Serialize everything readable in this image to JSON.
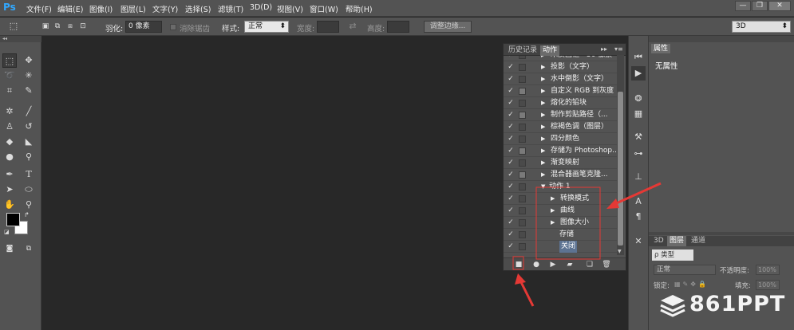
{
  "menubar": {
    "logo": "Ps",
    "items": [
      "文件(F)",
      "编辑(E)",
      "图像(I)",
      "图层(L)",
      "文字(Y)",
      "选择(S)",
      "滤镜(T)",
      "3D(D)",
      "视图(V)",
      "窗口(W)",
      "帮助(H)"
    ],
    "min": "—",
    "restore": "❐",
    "close": "✕"
  },
  "options": {
    "feather_label": "羽化:",
    "feather_value": "0 像素",
    "antialias_label": "消除锯齿",
    "style_label": "样式:",
    "style_value": "正常",
    "width_label": "宽度:",
    "height_label": "高度:",
    "refine_button": "调整边缘...",
    "workspace_value": "3D"
  },
  "actions_panel": {
    "tab_history": "历史记录",
    "tab_actions": "动作",
    "rows": [
      {
        "label": "木质画框 - 50 像素",
        "dialog": false,
        "expand": true,
        "indent": 0
      },
      {
        "label": "投影（文字）",
        "dialog": false,
        "expand": true,
        "indent": 0
      },
      {
        "label": "水中倒影（文字）",
        "dialog": false,
        "expand": true,
        "indent": 0
      },
      {
        "label": "自定义 RGB 到灰度",
        "dialog": true,
        "expand": true,
        "indent": 0
      },
      {
        "label": "熔化的铅块",
        "dialog": false,
        "expand": true,
        "indent": 0
      },
      {
        "label": "制作剪贴路径（...",
        "dialog": true,
        "expand": true,
        "indent": 0
      },
      {
        "label": "棕褐色调（图层）",
        "dialog": false,
        "expand": true,
        "indent": 0
      },
      {
        "label": "四分颜色",
        "dialog": false,
        "expand": true,
        "indent": 0
      },
      {
        "label": "存储为 Photoshop...",
        "dialog": true,
        "expand": true,
        "indent": 0
      },
      {
        "label": "渐变映射",
        "dialog": false,
        "expand": true,
        "indent": 0
      },
      {
        "label": "混合器画笔克隆...",
        "dialog": true,
        "expand": true,
        "indent": 0
      },
      {
        "label": "动作 1",
        "dialog": false,
        "expand": "open",
        "indent": 0
      },
      {
        "label": "转换模式",
        "dialog": false,
        "expand": true,
        "indent": 1
      },
      {
        "label": "曲线",
        "dialog": false,
        "expand": true,
        "indent": 1
      },
      {
        "label": "图像大小",
        "dialog": false,
        "expand": true,
        "indent": 1
      },
      {
        "label": "存储",
        "dialog": false,
        "expand": false,
        "indent": 1
      },
      {
        "label": "关闭",
        "dialog": false,
        "expand": false,
        "indent": 1,
        "selected": true
      }
    ]
  },
  "properties": {
    "tab": "属性",
    "text": "无属性"
  },
  "layers": {
    "tab_3d": "3D",
    "tab_layers": "图层",
    "tab_channels": "通道",
    "kind": "ρ 类型",
    "blend": "正常",
    "opacity_label": "不透明度:",
    "opacity_value": "100%",
    "lock_label": "锁定:",
    "fill_label": "填充:",
    "fill_value": "100%"
  },
  "watermark": "861PPT",
  "colors": {
    "annotation": "#e53935",
    "selection": "#5d7392"
  }
}
